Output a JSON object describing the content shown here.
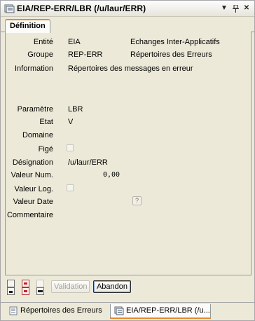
{
  "window": {
    "title": "EIA/REP-ERR/LBR (/u/laur/ERR)",
    "controls": {
      "menu": "▼",
      "pin": "ᚬ",
      "close": "✕"
    }
  },
  "tabs": [
    {
      "label": "Définition"
    }
  ],
  "fields": {
    "entite": {
      "label": "Entité",
      "value": "EIA",
      "desc": "Echanges Inter-Applicatifs"
    },
    "groupe": {
      "label": "Groupe",
      "value": "REP-ERR",
      "desc": "Répertoires des Erreurs"
    },
    "information": {
      "label": "Information",
      "value": "Répertoires des messages en erreur"
    },
    "parametre": {
      "label": "Paramètre",
      "value": "LBR"
    },
    "etat": {
      "label": "Etat",
      "value": "V"
    },
    "domaine": {
      "label": "Domaine",
      "value": ""
    },
    "fige": {
      "label": "Figé",
      "checked": false
    },
    "designation": {
      "label": "Désignation",
      "value": "/u/laur/ERR"
    },
    "valeur_num": {
      "label": "Valeur Num.",
      "value": "0,00"
    },
    "valeur_log": {
      "label": "Valeur Log.",
      "checked": false
    },
    "valeur_date": {
      "label": "Valeur Date",
      "value": "",
      "help": "?"
    },
    "commentaire": {
      "label": "Commentaire",
      "value": ""
    }
  },
  "toolbar": {
    "validation_label": "Validation",
    "abandon_label": "Abandon"
  },
  "bottom_tabs": [
    {
      "label": "Répertoires des Erreurs",
      "icon": "document-icon"
    },
    {
      "label": "EIA/REP-ERR/LBR (/u...",
      "icon": "document-icon"
    }
  ],
  "colors": {
    "accent": "#e68b2c",
    "background": "#ece9d8",
    "tab_bg": "#fbfbf9"
  }
}
